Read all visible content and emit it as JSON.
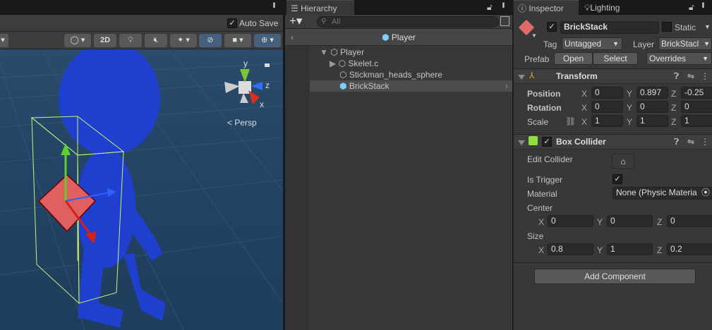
{
  "scene": {
    "auto_save_label": "Auto Save",
    "auto_save_checked": true,
    "toolbar": {
      "mode_2d": "2D"
    },
    "persp_label": "Persp",
    "gizmo_axes": {
      "x": "x",
      "y": "y",
      "z": "z"
    }
  },
  "hierarchy": {
    "tab_label": "Hierarchy",
    "search_placeholder": "All",
    "breadcrumb": "Player",
    "items": [
      {
        "label": "Player",
        "expanded": true
      },
      {
        "label": "Skelet.c",
        "expanded": false
      },
      {
        "label": "Stickman_heads_sphere"
      },
      {
        "label": "BrickStack",
        "selected": true
      }
    ]
  },
  "inspector": {
    "tabs": [
      "Inspector",
      "Lighting"
    ],
    "object_name": "BrickStack",
    "active": true,
    "static_label": "Static",
    "tag_label": "Tag",
    "tag_value": "Untagged",
    "layer_label": "Layer",
    "layer_value": "BrickStacl",
    "prefab_label": "Prefab",
    "open_label": "Open",
    "select_label": "Select",
    "overrides_label": "Overrides",
    "transform": {
      "title": "Transform",
      "position_label": "Position",
      "position": {
        "x": "0",
        "y": "0.897",
        "z": "-0.25"
      },
      "rotation_label": "Rotation",
      "rotation": {
        "x": "0",
        "y": "0",
        "z": "0"
      },
      "scale_label": "Scale",
      "scale": {
        "x": "1",
        "y": "1",
        "z": "1"
      }
    },
    "box_collider": {
      "title": "Box Collider",
      "enabled": true,
      "edit_collider_label": "Edit Collider",
      "is_trigger_label": "Is Trigger",
      "is_trigger": true,
      "material_label": "Material",
      "material_value": "None (Physic Materia",
      "center_label": "Center",
      "center": {
        "x": "0",
        "y": "0",
        "z": "0"
      },
      "size_label": "Size",
      "size": {
        "x": "0.8",
        "y": "1",
        "z": "0.2"
      }
    },
    "add_component_label": "Add Component",
    "axis_labels": {
      "x": "X",
      "y": "Y",
      "z": "Z"
    }
  },
  "colors": {
    "accent_selected": "#46607c",
    "scene_bg": "#244466",
    "figure": "#1f3fcf"
  }
}
